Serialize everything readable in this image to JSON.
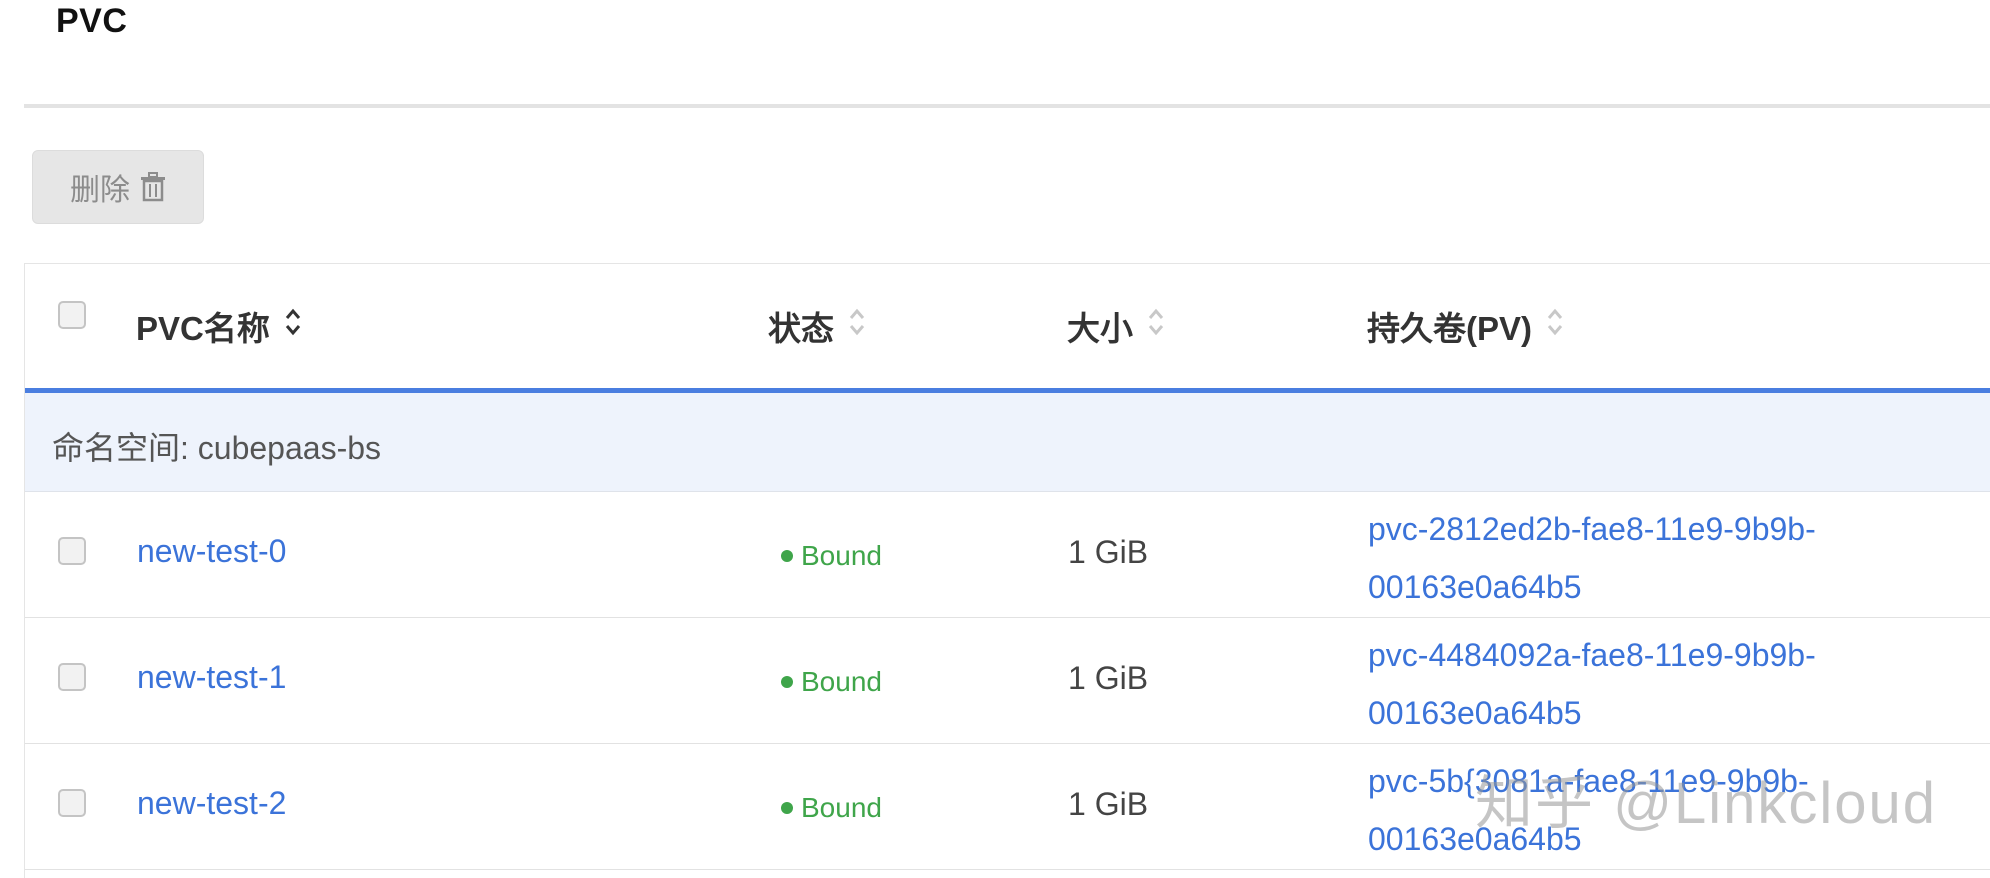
{
  "page": {
    "title": "PVC"
  },
  "toolbar": {
    "delete_label": "删除"
  },
  "table": {
    "columns": [
      {
        "label": "PVC名称"
      },
      {
        "label": "状态"
      },
      {
        "label": "大小"
      },
      {
        "label": "持久卷(PV)"
      }
    ],
    "group": {
      "label": "命名空间: cubepaas-bs"
    },
    "rows": [
      {
        "name": "new-test-0",
        "status": "Bound",
        "size": "1 GiB",
        "pv_line1": "pvc-2812ed2b-fae8-11e9-9b9b-",
        "pv_line2": "00163e0a64b5"
      },
      {
        "name": "new-test-1",
        "status": "Bound",
        "size": "1 GiB",
        "pv_line1": "pvc-4484092a-fae8-11e9-9b9b-",
        "pv_line2": "00163e0a64b5"
      },
      {
        "name": "new-test-2",
        "status": "Bound",
        "size": "1 GiB",
        "pv_line1": "pvc-5b{3081a-fae8-11e9-9b9b-",
        "pv_line2": "00163e0a64b5"
      }
    ]
  },
  "watermark": {
    "text": "知乎 @Linkcloud"
  },
  "colors": {
    "accent": "#4a7ee0",
    "link": "#3b73d9",
    "status_bound": "#3fa54a",
    "group_bg": "#eef3fc"
  },
  "icons": {
    "delete": "trash-icon",
    "sort": "sort-icon"
  }
}
